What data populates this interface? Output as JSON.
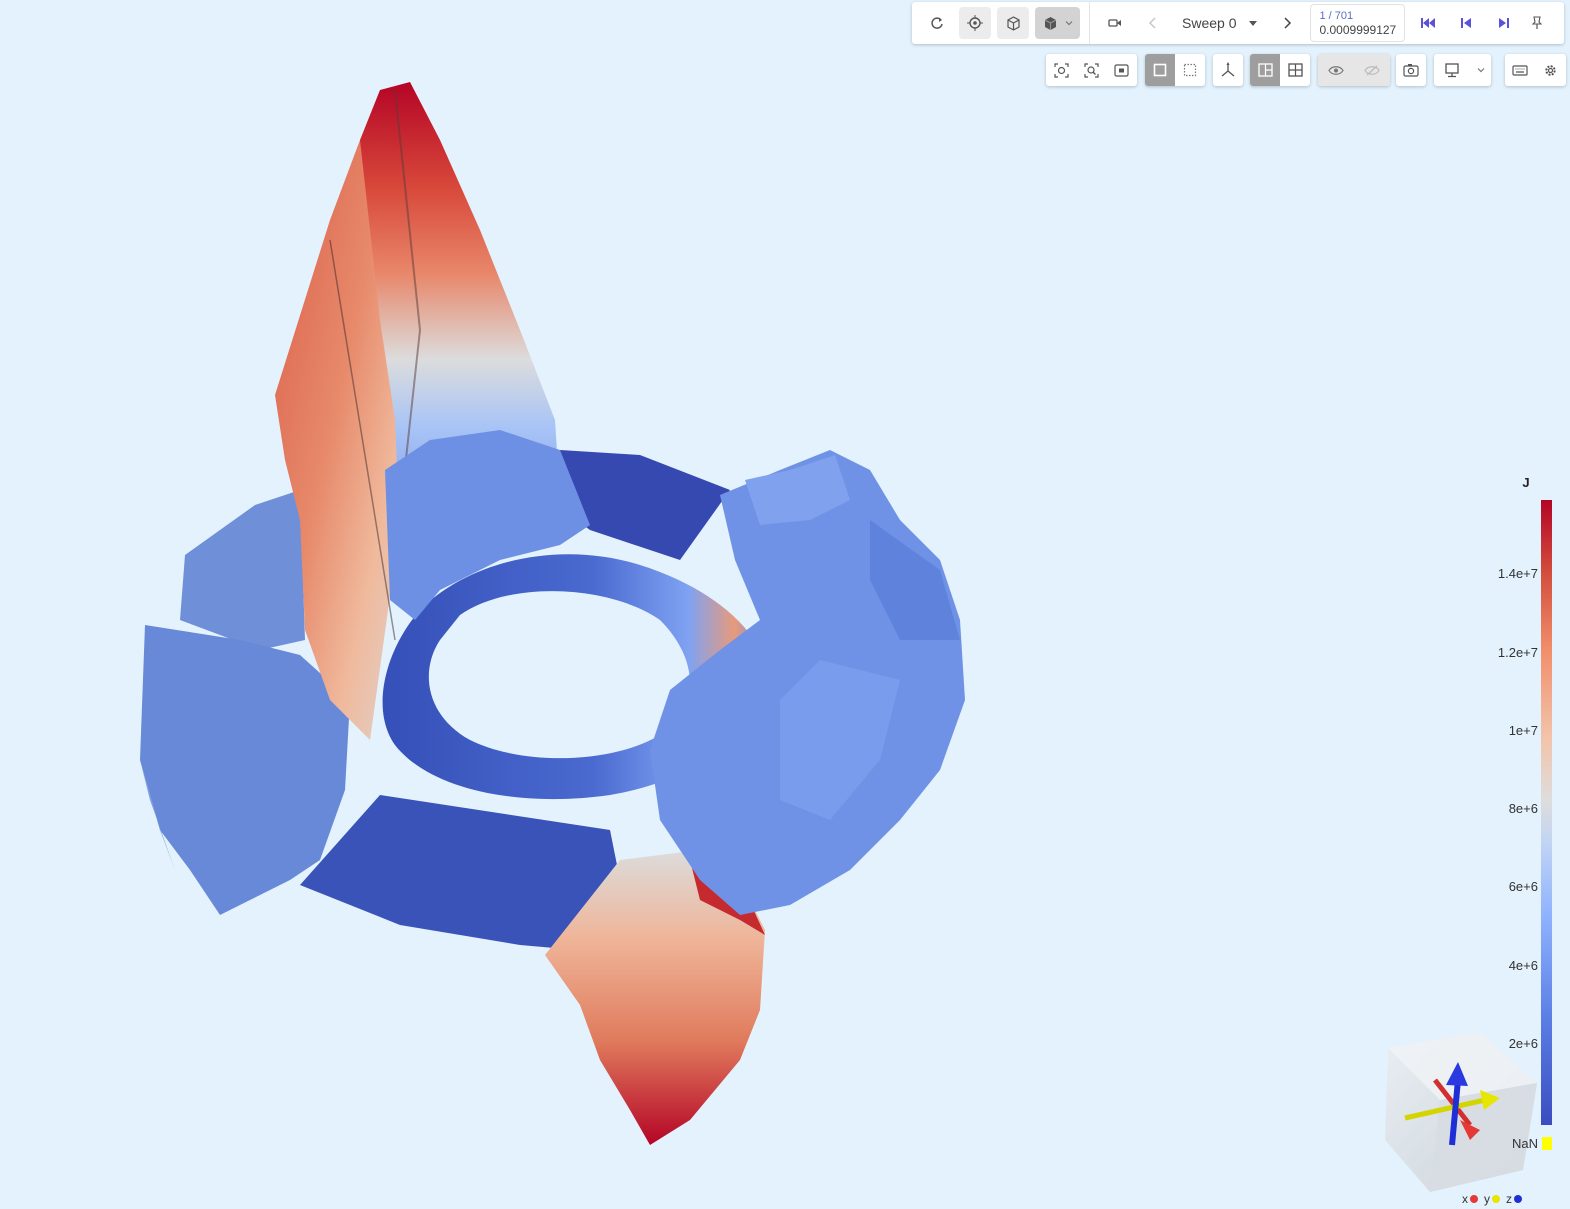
{
  "toolbar": {
    "sweep_label": "Sweep 0",
    "step_counter": "1 / 701",
    "time_value": "0.0009999127",
    "icons": [
      "refresh-icon",
      "target-icon",
      "cube-outline-icon",
      "cube-solid-icon",
      "chevron-down-icon",
      "record-icon",
      "chevron-left-icon",
      "caret-down-icon",
      "chevron-right-icon",
      "skip-first-icon",
      "step-back-icon",
      "step-forward-icon",
      "pin-icon"
    ]
  },
  "secondary_toolbar": {
    "icons": [
      "focus-icon",
      "zoom-fit-icon",
      "frame-icon",
      "solid-square-icon",
      "dotted-square-icon",
      "axes-icon",
      "split-view-icon",
      "grid-icon",
      "eye-icon",
      "eye-off-icon",
      "camera-icon",
      "monitor-icon",
      "chevron-down-icon",
      "keyboard-icon",
      "gear-icon"
    ]
  },
  "legend": {
    "title": "J",
    "ticks": [
      "1.4e+7",
      "1.2e+7",
      "1e+7",
      "8e+6",
      "6e+6",
      "4e+6",
      "2e+6"
    ],
    "nan_label": "NaN",
    "colors": {
      "min": "#3b4cc0",
      "mid": "#dddddd",
      "max": "#b40426",
      "nan": "#ffff00"
    }
  },
  "axes": {
    "x_label": "x",
    "y_label": "y",
    "z_label": "z",
    "x_color": "#e53935",
    "y_color": "#e6e600",
    "z_color": "#1e2fd6"
  }
}
